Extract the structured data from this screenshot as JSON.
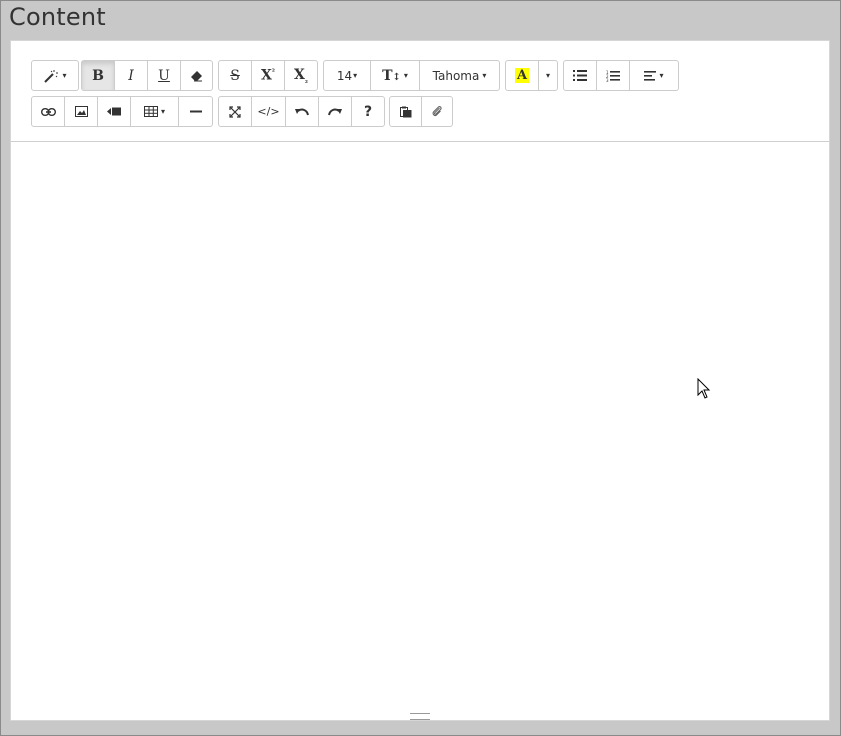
{
  "page": {
    "title": "Content"
  },
  "toolbar": {
    "row1": {
      "style_caret": "▾",
      "bold": "B",
      "italic": "I",
      "underline": "U",
      "strikethrough": "S",
      "superscript": "X",
      "superscript_mark": "²",
      "subscript": "X",
      "subscript_mark": "₂",
      "font_size": "14",
      "font_size_caret": "▾",
      "line_height": "T",
      "line_height_caret": "▾",
      "font_name": "Tahoma",
      "font_name_caret": "▾",
      "color_letter": "A",
      "color_highlight": "#ffff00",
      "color_caret": "▾",
      "para_caret": "▾"
    },
    "row2": {
      "table_caret": "▾",
      "codeview": "</>",
      "help": "?"
    }
  }
}
